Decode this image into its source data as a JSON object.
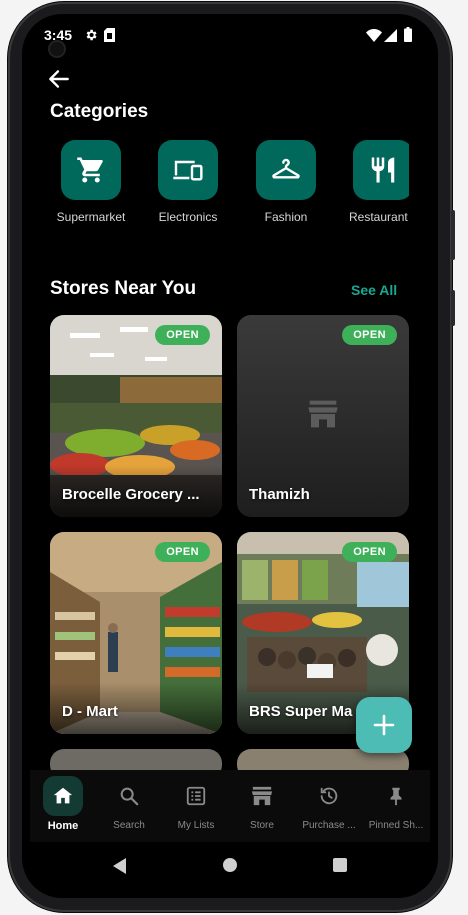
{
  "status_bar": {
    "time": "3:45"
  },
  "header": {
    "back_icon": "arrow-left-icon"
  },
  "categories": {
    "title": "Categories",
    "items": [
      {
        "label": "Supermarket",
        "icon": "cart-icon"
      },
      {
        "label": "Electronics",
        "icon": "devices-icon"
      },
      {
        "label": "Fashion",
        "icon": "hanger-icon"
      },
      {
        "label": "Restaurant",
        "icon": "fork-knife-icon"
      }
    ]
  },
  "stores": {
    "title": "Stores Near You",
    "see_all": "See All",
    "items": [
      {
        "name": "Brocelle Grocery ...",
        "badge": "OPEN"
      },
      {
        "name": "Thamizh",
        "badge": "OPEN"
      },
      {
        "name": "D - Mart",
        "badge": "OPEN"
      },
      {
        "name": "BRS Super Ma",
        "badge": "OPEN"
      }
    ]
  },
  "bottom_nav": {
    "items": [
      {
        "label": "Home",
        "icon": "home-icon",
        "active": true
      },
      {
        "label": "Search",
        "icon": "search-icon"
      },
      {
        "label": "My Lists",
        "icon": "list-icon"
      },
      {
        "label": "Store",
        "icon": "store-icon"
      },
      {
        "label": "Purchase ...",
        "icon": "history-icon"
      },
      {
        "label": "Pinned Sh...",
        "icon": "pin-icon"
      }
    ]
  },
  "colors": {
    "accent": "#00695c",
    "see_all": "#1aa695",
    "badge": "#3fb05a",
    "fab": "#4cbcb4",
    "background": "#000000"
  }
}
